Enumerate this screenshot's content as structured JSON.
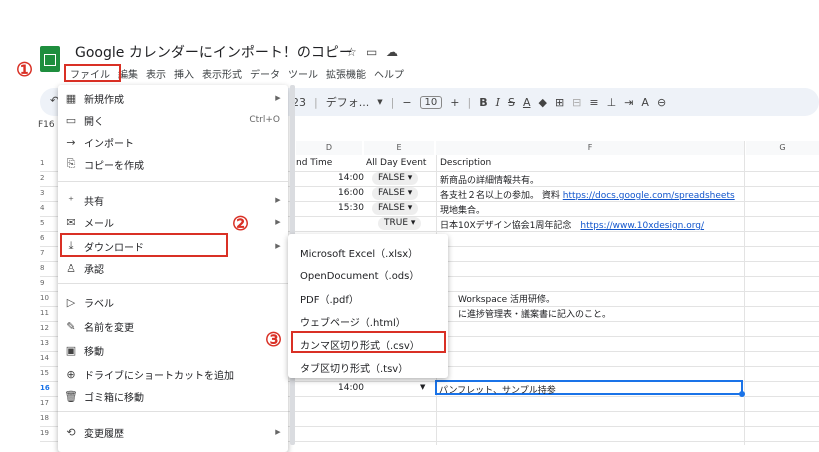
{
  "title": "Google カレンダーにインポート！のコピー",
  "title_icons": [
    "star-icon",
    "folder-icon",
    "cloud-icon"
  ],
  "menubar": [
    "ファイル",
    "編集",
    "表示",
    "挿入",
    "表示形式",
    "データ",
    "ツール",
    "拡張機能",
    "ヘルプ"
  ],
  "toolbar": {
    "zoom_tail": "23",
    "font": "デフォ...",
    "font_size": "10",
    "minus": "−",
    "plus": "+"
  },
  "name_box": "F16",
  "callouts": [
    "①",
    "②",
    "③"
  ],
  "columns": [
    "D",
    "E",
    "F",
    "G"
  ],
  "rows": [
    "1",
    "2",
    "3",
    "4",
    "5",
    "6",
    "7",
    "8",
    "9",
    "10",
    "11",
    "12",
    "13",
    "14",
    "15",
    "16",
    "17",
    "18",
    "19"
  ],
  "cells": {
    "d1": "nd Time",
    "e1": "All Day Event",
    "f1": "Description",
    "d2": "14:00",
    "e2": "FALSE",
    "f2": "新商品の詳細情報共有。",
    "d3": "16:00",
    "e3": "FALSE",
    "f3": "各支社２名以上の参加。 資料",
    "f3_link": "https://docs.google.com/spreadsheets",
    "d4": "15:30",
    "e4": "FALSE",
    "f4": "現地集合。",
    "e5": "TRUE",
    "f5": "日本10Xデザイン協会1周年記念",
    "f5_link": "https://www.10xdesign.org/",
    "f10": "Workspace 活用研修。",
    "f11": "に進捗管理表・議案書に記入のこと。",
    "d16": "14:00",
    "f16": "パンフレット、サンプル持参"
  },
  "file_menu": {
    "new": "新規作成",
    "open": "開く",
    "open_shortcut": "Ctrl+O",
    "import": "インポート",
    "copy": "コピーを作成",
    "share": "共有",
    "email": "メール",
    "download": "ダウンロード",
    "approve": "承認",
    "rename_label": "ラベル",
    "rename": "名前を変更",
    "move": "移動",
    "shortcut": "ドライブにショートカットを追加",
    "trash": "ゴミ箱に移動",
    "history": "変更履歴"
  },
  "download_menu": [
    "Microsoft Excel（.xlsx）",
    "OpenDocument（.ods）",
    "PDF（.pdf）",
    "ウェブページ（.html）",
    "カンマ区切り形式（.csv）",
    "タブ区切り形式（.tsv）"
  ],
  "colors": {
    "accent_red": "#d93025",
    "sheets_green": "#1e8e3e",
    "link": "#1155cc"
  }
}
